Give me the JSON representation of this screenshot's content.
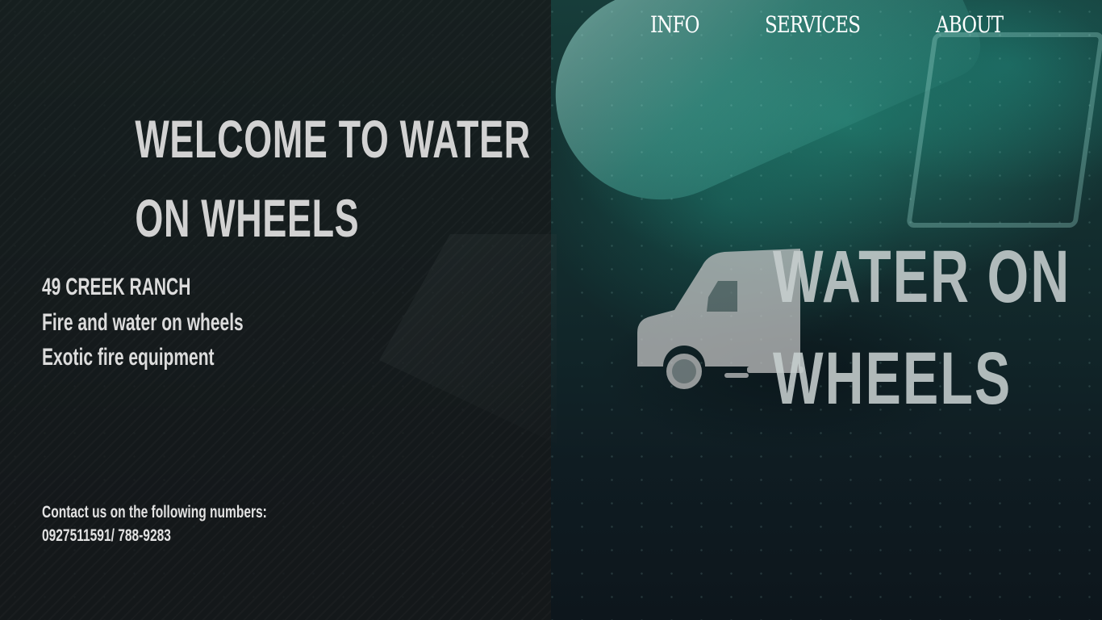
{
  "nav": {
    "items": [
      {
        "label": "INFO"
      },
      {
        "label": "SERVICES"
      },
      {
        "label": "ABOUT"
      }
    ]
  },
  "hero": {
    "welcome_line1": "WELCOME TO WATER",
    "welcome_line2": "ON WHEELS",
    "address": "49 CREEK RANCH",
    "tagline": "Fire and water on wheels",
    "subtagline": "Exotic fire equipment",
    "contact_label": "Contact us on the following numbers:",
    "contact_numbers": "0927511591/ 788-9283"
  },
  "brand": {
    "line1": "WATER ON",
    "line2": "WHEELS",
    "logo_icon": "truck-icon"
  },
  "colors": {
    "accent_teal": "#2a9d8f",
    "panel_dark": "#16181a",
    "text_light": "#d2d2d2"
  }
}
